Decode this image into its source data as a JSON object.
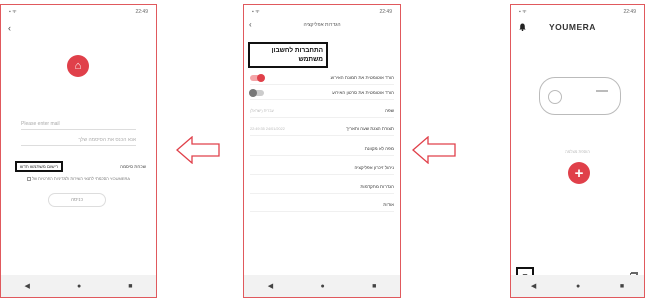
{
  "left_screen": {
    "status_time": "22:49",
    "back_glyph": "‹",
    "logo_icon": "hybrid-logo",
    "logo_glyph": "⌂",
    "email_placeholder": "Please enter mail",
    "password_placeholder": "אנא הכנס את הסיסמה שלך",
    "forgot_label": "שכחת סיסמה",
    "register_label": "רישום משתמש חדש",
    "terms_text": "הסכמתי לתנאי השירות ולמדיניות הפרטיות של YOUMERA",
    "login_button": "כניסה"
  },
  "middle_screen": {
    "status_time": "22:49",
    "title": "הגדרות אפליקציה",
    "back_glyph": "‹",
    "account_label": "התחברות לחשבון משתמש",
    "rows": [
      {
        "label": "הורד אוטומטית את תמונת האירוע",
        "value": ""
      },
      {
        "label": "הורד אוטומטית את סרטון האירוע",
        "value": ""
      },
      {
        "label": "שפה",
        "value": "עברית (ישראל)"
      },
      {
        "label": "תצורת הצגת שעה ותאריך",
        "value": "24/01/2022 22:49:35"
      },
      {
        "label": "מפה לא מקוונת",
        "value": ""
      },
      {
        "label": "ניהול זיכרון אפליקציה",
        "value": ""
      },
      {
        "label": "הגדרות מתקדמות",
        "value": ""
      },
      {
        "label": "אודות",
        "value": ""
      }
    ],
    "toggle_event_image": true,
    "toggle_event_video": false
  },
  "right_screen": {
    "status_time": "22:49",
    "brand": "YOUMERA",
    "add_device_text": "הוספת מצלמה",
    "add_glyph": "+",
    "menu_glyph": "≡",
    "bell_glyph": "🔔",
    "gallery_glyph": "🖼"
  },
  "nav": {
    "back": "◀",
    "home": "●",
    "recent": "■"
  },
  "colors": {
    "accent": "#e0404a",
    "frame": "#e0595d",
    "highlight_box": "#111111"
  }
}
